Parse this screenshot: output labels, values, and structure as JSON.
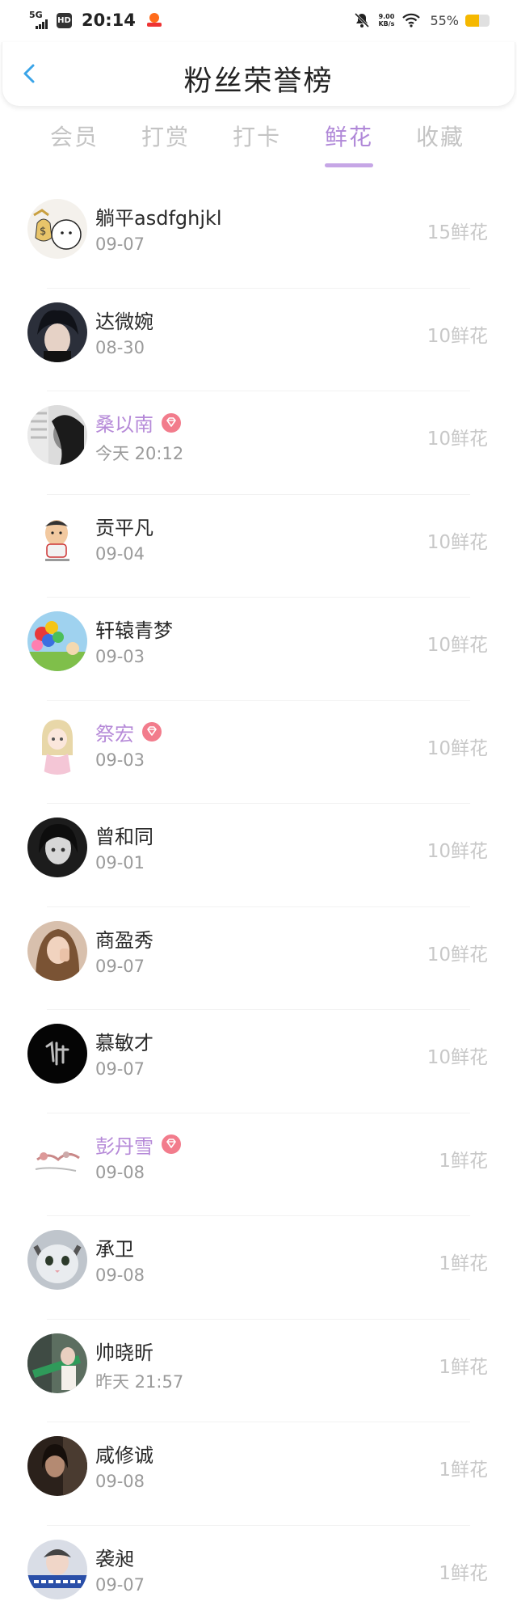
{
  "status_bar": {
    "network": "5G",
    "hd": "HD",
    "time": "20:14",
    "speed_value": "9.00",
    "speed_unit": "KB/s",
    "battery_pct": "55%",
    "battery_level": 0.55,
    "icons": [
      "signal-icon",
      "hd-icon",
      "app-notification-icon",
      "mute-icon",
      "wifi-icon",
      "battery-icon"
    ]
  },
  "header": {
    "title": "粉丝荣誉榜",
    "back_icon": "chevron-left-icon"
  },
  "tabs": [
    {
      "label": "会员",
      "active": false
    },
    {
      "label": "打赏",
      "active": false
    },
    {
      "label": "打卡",
      "active": false
    },
    {
      "label": "鲜花",
      "active": true
    },
    {
      "label": "收藏",
      "active": false
    }
  ],
  "colors": {
    "accent": "#b088d8",
    "vip_name": "#b68ad8",
    "vip_badge": "#f27c8c",
    "back_arrow": "#3aa4e8"
  },
  "fans": [
    {
      "name": "躺平asdfghjkl",
      "date": "09-07",
      "amount": "15鲜花",
      "vip": false,
      "avatar": "cartoon-money-bag"
    },
    {
      "name": "达微婉",
      "date": "08-30",
      "amount": "10鲜花",
      "vip": false,
      "avatar": "dark-hair-person"
    },
    {
      "name": "桑以南",
      "date": "今天 20:12",
      "amount": "10鲜花",
      "vip": true,
      "avatar": "bw-portrait"
    },
    {
      "name": "贡平凡",
      "date": "09-04",
      "amount": "10鲜花",
      "vip": false,
      "avatar": "cartoon-man"
    },
    {
      "name": "轩辕青梦",
      "date": "09-03",
      "amount": "10鲜花",
      "vip": false,
      "avatar": "balloons"
    },
    {
      "name": "祭宏",
      "date": "09-03",
      "amount": "10鲜花",
      "vip": true,
      "avatar": "anime-girl"
    },
    {
      "name": "曾和同",
      "date": "09-01",
      "amount": "10鲜花",
      "vip": false,
      "avatar": "dark-anime"
    },
    {
      "name": "商盈秀",
      "date": "09-07",
      "amount": "10鲜花",
      "vip": false,
      "avatar": "woman-portrait"
    },
    {
      "name": "慕敏才",
      "date": "09-07",
      "amount": "10鲜花",
      "vip": false,
      "avatar": "black-calligraphy"
    },
    {
      "name": "彭丹雪",
      "date": "09-08",
      "amount": "1鲜花",
      "vip": true,
      "avatar": "flower-sketch"
    },
    {
      "name": "承卫",
      "date": "09-08",
      "amount": "1鲜花",
      "vip": false,
      "avatar": "cat-face"
    },
    {
      "name": "帅晓昕",
      "date": "昨天 21:57",
      "amount": "1鲜花",
      "vip": false,
      "avatar": "street-photo"
    },
    {
      "name": "咸修诚",
      "date": "09-08",
      "amount": "1鲜花",
      "vip": false,
      "avatar": "dark-woman"
    },
    {
      "name": "袭昶",
      "date": "09-07",
      "amount": "1鲜花",
      "vip": false,
      "avatar": "blue-banner"
    }
  ]
}
